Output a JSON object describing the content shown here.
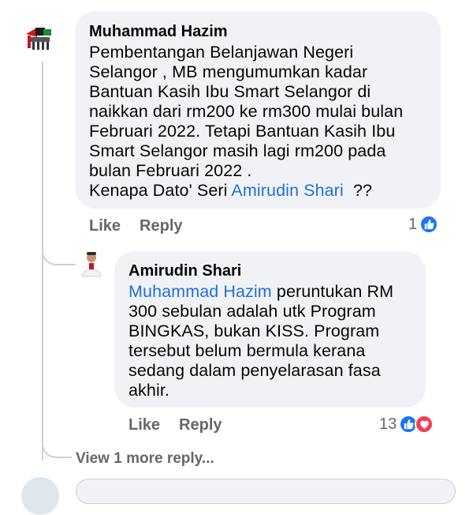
{
  "comment": {
    "author": "Muhammad Hazim",
    "text_main": "Pembentangan Belanjawan Negeri\nSelangor , MB mengumumkan kadar\nBantuan Kasih Ibu Smart Selangor di\nnaikkan dari rm200 ke rm300 mulai bulan\nFebruari 2022. Tetapi Bantuan Kasih Ibu\nSmart Selangor masih lagi rm200 pada\nbulan Februari 2022 .\nKenapa Dato' Seri ",
    "mention": "Amirudin Shari",
    "text_tail": "  ??",
    "like_label": "Like",
    "reply_label": "Reply",
    "reaction_count": "1",
    "reaction_icons": [
      "like-icon"
    ]
  },
  "reply": {
    "author": "Amirudin Shari",
    "mention": "Muhammad Hazim",
    "text": " peruntukan RM\n300 sebulan adalah utk Program\nBINGKAS, bukan KISS. Program\ntersebut belum bermula kerana\nsedang dalam penyelarasan fasa\nakhir.",
    "like_label": "Like",
    "reply_label": "Reply",
    "reaction_count": "13",
    "reaction_icons": [
      "like-icon",
      "love-icon"
    ]
  },
  "view_more_replies": "View 1 more reply...",
  "colors": {
    "bubble": "#f0f2f5",
    "mention": "#216fdb",
    "meta": "#65676b",
    "like": "#1877f2",
    "love": "#f33e58"
  }
}
